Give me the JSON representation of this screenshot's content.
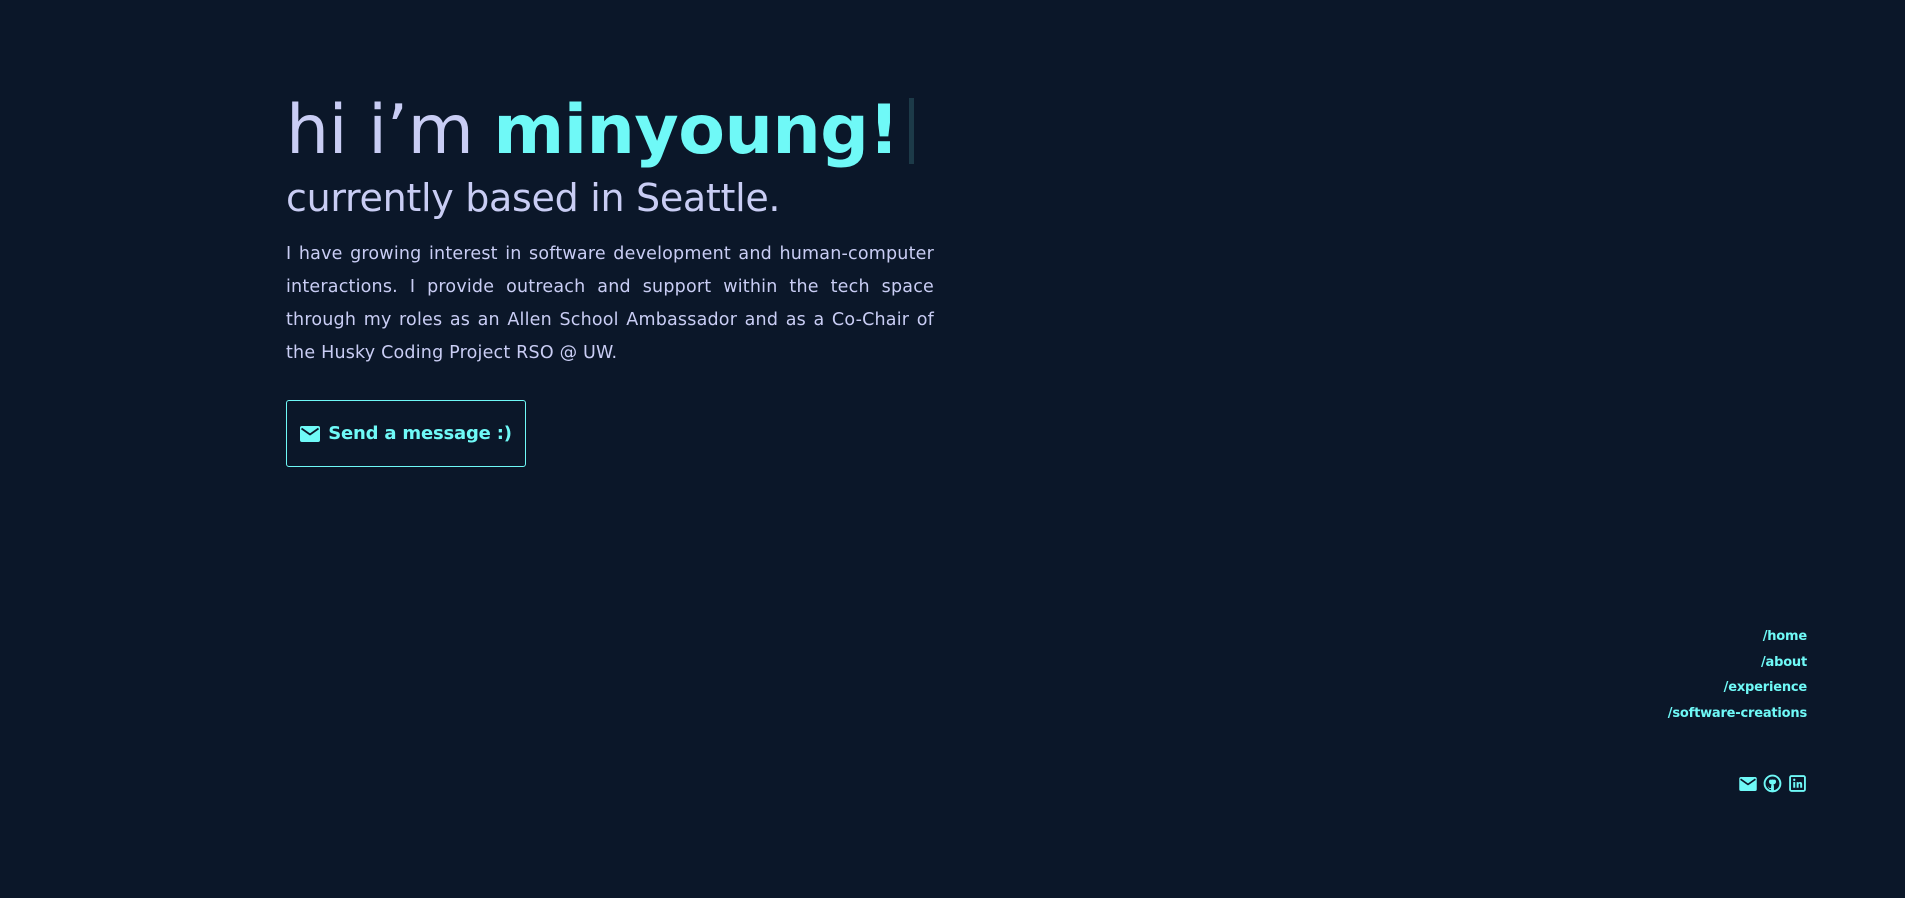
{
  "theme": {
    "background": "#0b1729",
    "accent": "#6ff9f7",
    "text": "#c9cdf4"
  },
  "hero": {
    "greeting": "hi i’m",
    "name": "minyoung!",
    "subtitle": "currently based in Seattle.",
    "bio": "I have growing interest in software development and human-computer interactions. I provide outreach and support within the tech space through my roles as an Allen School Ambassador and as a Co-Chair of the Husky Coding Project RSO @ UW."
  },
  "cta": {
    "label": "Send a message :)",
    "icon": "mail-icon"
  },
  "nav": {
    "items": [
      {
        "label": "/home"
      },
      {
        "label": "/about"
      },
      {
        "label": "/experience"
      },
      {
        "label": "/software-creations"
      }
    ]
  },
  "socials": {
    "items": [
      {
        "icon": "mail-icon"
      },
      {
        "icon": "github-icon"
      },
      {
        "icon": "linkedin-icon"
      }
    ]
  }
}
